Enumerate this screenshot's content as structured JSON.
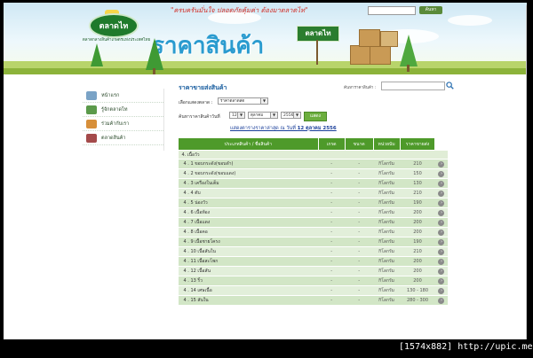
{
  "header": {
    "slogan": "\"ครบครันมั่นใจ  ปลอดภัยคุ้มค่า  ต้องมาตลาดไท\"",
    "logo_text": "ตลาดไท",
    "tagline": "ตลาดกลางสินค้าเกษตรแห่งประเทศไทย",
    "search_button": "ค้นหา",
    "page_title": "ราคาสินค้า",
    "sign_text": "ตลาดไท"
  },
  "sidebar": {
    "items": [
      {
        "label": "หน้าแรก",
        "icon": "home-icon",
        "color": "#7aa3c6"
      },
      {
        "label": "รู้จักตลาดไท",
        "icon": "info-icon",
        "color": "#5b9a4a"
      },
      {
        "label": "ร่วมค้ากับเรา",
        "icon": "partner-icon",
        "color": "#d78f3a"
      },
      {
        "label": "ตลาดสินค้า",
        "icon": "market-icon",
        "color": "#a44a4a"
      }
    ]
  },
  "main": {
    "section_title": "ราคาขายส่งสินค้า",
    "product_search_label": "ค้นหาราคาสินค้า :",
    "market_label": "เลือกแสดงตลาด :",
    "market_value": "ราคาตลาดสด",
    "date_label": "ค้นหาราคาสินค้าวันที่",
    "day": "12",
    "month": "ตุลาคม",
    "year": "2556",
    "show_button": "แสดง",
    "update_line_prefix": "แสดงตารางราคาล่าสุด ณ วันที่ ",
    "update_date": "12 ตุลาคม 2556"
  },
  "table": {
    "headers": [
      "ประเภทสินค้า / ชื่อสินค้า",
      "เกรด",
      "ขนาด",
      "หน่วยนับ",
      "ราคาขายส่ง"
    ],
    "category": "4. เนื้อวัว",
    "rows": [
      {
        "name": "4 . 1   ขอบกระดัง(ขอบดำ)",
        "grade": "-",
        "size": "-",
        "unit": "กิโลกรัม",
        "price": "210"
      },
      {
        "name": "4 . 2   ขอบกระดัง(ขอบแดง)",
        "grade": "-",
        "size": "-",
        "unit": "กิโลกรัม",
        "price": "150"
      },
      {
        "name": "4 . 3   เครื่องในเต็ม",
        "grade": "-",
        "size": "-",
        "unit": "กิโลกรัม",
        "price": "130"
      },
      {
        "name": "4 . 4   ตับ",
        "grade": "-",
        "size": "-",
        "unit": "กิโลกรัม",
        "price": "210"
      },
      {
        "name": "4 . 5   น่องวัว",
        "grade": "-",
        "size": "-",
        "unit": "กิโลกรัม",
        "price": "190"
      },
      {
        "name": "4 . 6   เนื้อท้อง",
        "grade": "-",
        "size": "-",
        "unit": "กิโลกรัม",
        "price": "200"
      },
      {
        "name": "4 . 7   เนื้อแดง",
        "grade": "-",
        "size": "-",
        "unit": "กิโลกรัม",
        "price": "200"
      },
      {
        "name": "4 . 8   เนื้อคอ",
        "grade": "-",
        "size": "-",
        "unit": "กิโลกรัม",
        "price": "200"
      },
      {
        "name": "4 . 9   เนื้อชายโครง",
        "grade": "-",
        "size": "-",
        "unit": "กิโลกรัม",
        "price": "190"
      },
      {
        "name": "4 . 10   เนื้อสันใน",
        "grade": "-",
        "size": "-",
        "unit": "กิโลกรัม",
        "price": "210"
      },
      {
        "name": "4 . 11   เนื้อสะโพก",
        "grade": "-",
        "size": "-",
        "unit": "กิโลกรัม",
        "price": "200"
      },
      {
        "name": "4 . 12   เนื้อสัน",
        "grade": "-",
        "size": "-",
        "unit": "กิโลกรัม",
        "price": "200"
      },
      {
        "name": "4 . 13   ริ้ว",
        "grade": "-",
        "size": "-",
        "unit": "กิโลกรัม",
        "price": "200"
      },
      {
        "name": "4 . 14   เศษเนื้อ",
        "grade": "-",
        "size": "-",
        "unit": "กิโลกรัม",
        "price": "130 - 180"
      },
      {
        "name": "4 . 15   สันใน",
        "grade": "-",
        "size": "-",
        "unit": "กิโลกรัม",
        "price": "280 - 300"
      }
    ]
  },
  "watermark": "[1574x882] http://upic.me/"
}
